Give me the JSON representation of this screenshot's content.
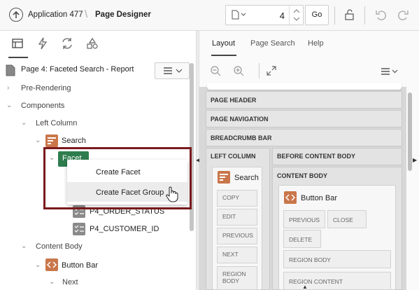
{
  "header": {
    "app_title": "Application 477",
    "designer_title": "Page Designer",
    "page_number": "4",
    "go_label": "Go"
  },
  "left": {
    "tabs": [
      "rendering-icon",
      "dynamic-actions-icon",
      "processing-icon",
      "shared-components-icon"
    ],
    "page_label": "Page 4: Faceted Search - Report",
    "tree": {
      "pre_rendering": "Pre-Rendering",
      "components": "Components",
      "left_column": "Left Column",
      "search": "Search",
      "facet": "Facet",
      "order_status": "P4_ORDER_STATUS",
      "customer_id": "P4_CUSTOMER_ID",
      "content_body": "Content Body",
      "button_bar": "Button Bar",
      "next": "Next"
    }
  },
  "context_menu": {
    "items": [
      "Create Facet",
      "Create Facet Group"
    ],
    "hovered_index": 1
  },
  "right": {
    "tabs": [
      "Layout",
      "Page Search",
      "Help"
    ],
    "active_tab": "Layout",
    "bars": {
      "page_header": "PAGE HEADER",
      "page_navigation": "PAGE NAVIGATION",
      "breadcrumb_bar": "BREADCRUMB BAR"
    },
    "left_column": {
      "title": "LEFT COLUMN",
      "region_title": "Search",
      "slots": [
        "COPY",
        "EDIT",
        "PREVIOUS",
        "NEXT",
        "REGION BODY"
      ]
    },
    "before_content_body": "BEFORE CONTENT BODY",
    "content_body": {
      "title": "CONTENT BODY",
      "region_title": "Button Bar",
      "slots": [
        "PREVIOUS",
        "CLOSE",
        "DELETE",
        "REGION BODY",
        "REGION CONTENT"
      ]
    }
  },
  "colors": {
    "facet_green": "#2e7d4f",
    "highlight_border": "#7a1a1d",
    "region_icon": "#c9764a"
  }
}
